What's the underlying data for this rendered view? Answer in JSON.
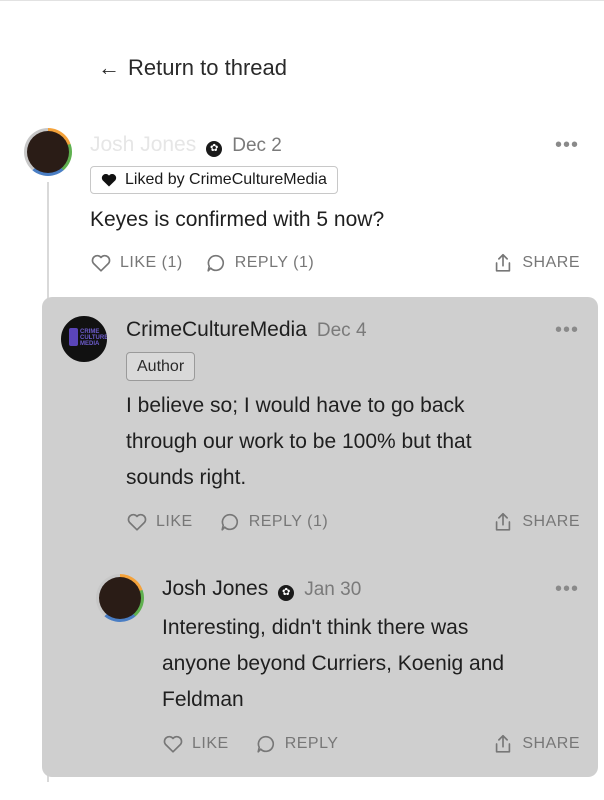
{
  "nav": {
    "back_arrow": "←",
    "back_label": "Return to thread"
  },
  "comments": [
    {
      "author": "Josh Jones",
      "badge": "✿",
      "date": "Dec 2",
      "liked_by": "Liked by CrimeCultureMedia",
      "text": "Keyes is confirmed with 5 now?",
      "like_label": "LIKE (1)",
      "reply_label": "REPLY (1)",
      "share_label": "SHARE"
    },
    {
      "author": "CrimeCultureMedia",
      "date": "Dec 4",
      "author_tag": "Author",
      "avatar_text": "CRIME CULTURE MEDIA",
      "text_lines": [
        "I believe so; I would have to go back",
        "through our work to be 100% but that",
        "sounds right."
      ],
      "like_label": "LIKE",
      "reply_label": "REPLY (1)",
      "share_label": "SHARE"
    },
    {
      "author": "Josh Jones",
      "badge": "✿",
      "date": "Jan 30",
      "text_lines": [
        "Interesting, didn't think there was",
        "anyone beyond Curriers, Koenig and",
        "Feldman"
      ],
      "like_label": "LIKE",
      "reply_label": "REPLY",
      "share_label": "SHARE"
    }
  ],
  "more_label": "•••",
  "icons": {
    "back": "arrow-left-icon",
    "heart_filled": "heart-filled-icon",
    "heart": "heart-icon",
    "comment": "comment-bubble-icon",
    "share": "share-upload-icon",
    "more": "more-dots-icon",
    "badge": "founding-badge-icon"
  },
  "colors": {
    "card_bg": "#cfcfcf",
    "muted": "#777777",
    "text": "#1f1f1f"
  }
}
